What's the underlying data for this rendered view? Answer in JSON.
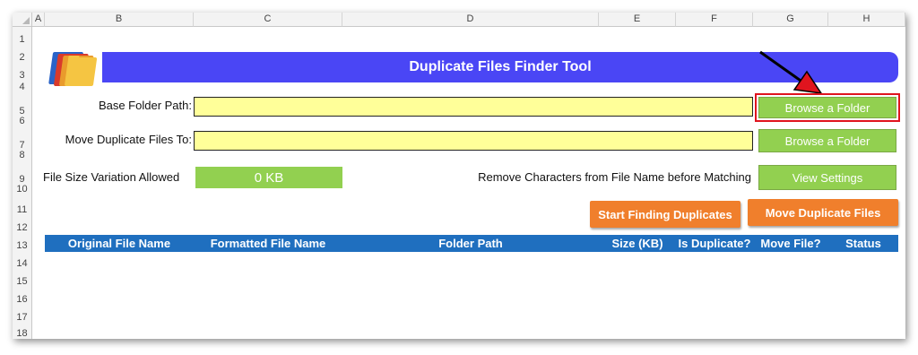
{
  "columns": [
    "A",
    "B",
    "C",
    "D",
    "E",
    "F",
    "G",
    "H"
  ],
  "rows": [
    "1",
    "2",
    "3",
    "4",
    "5",
    "6",
    "7",
    "8",
    "9",
    "10",
    "11",
    "12",
    "13",
    "14",
    "15",
    "16",
    "17",
    "18"
  ],
  "banner": {
    "title": "Duplicate Files Finder Tool"
  },
  "form": {
    "base_folder_label": "Base Folder Path:",
    "move_to_label": "Move Duplicate Files To:",
    "size_variation_label": "File Size Variation Allowed",
    "size_variation_value": "0 KB",
    "remove_chars_label": "Remove Characters from File Name before Matching"
  },
  "buttons": {
    "browse_base": "Browse a Folder",
    "browse_move": "Browse a Folder",
    "view_settings": "View Settings",
    "start": "Start Finding Duplicates",
    "move": "Move Duplicate Files"
  },
  "table": {
    "headers": [
      "Original File Name",
      "Formatted File Name",
      "Folder Path",
      "Size (KB)",
      "Is Duplicate?",
      "Move File?",
      "Status"
    ]
  },
  "colors": {
    "banner": "#4a46f5",
    "input_fill": "#ffff99",
    "green_button": "#92d050",
    "orange_button": "#f07f2c",
    "table_header": "#1f6fbf",
    "highlight": "#e0141e"
  },
  "icons": {
    "logo": "folders-icon",
    "pointer": "red-arrow-icon"
  }
}
